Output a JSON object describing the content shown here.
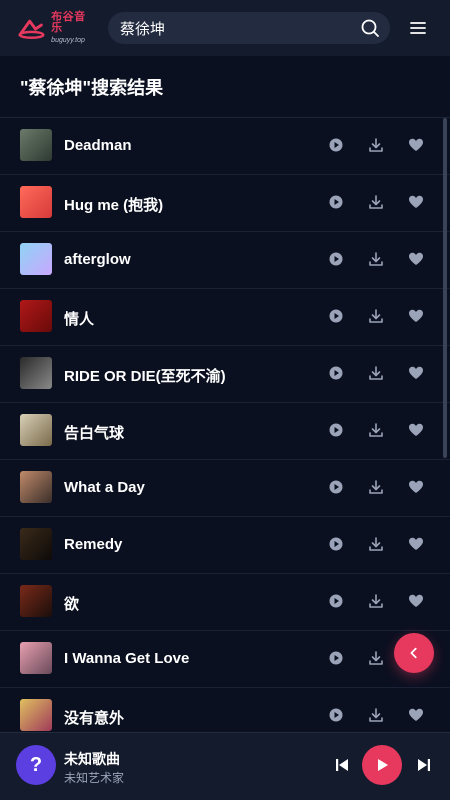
{
  "header": {
    "logo_text": "布谷音乐",
    "logo_sub": "buguyy.top",
    "search_value": "蔡徐坤"
  },
  "results_title": "\"蔡徐坤\"搜索结果",
  "songs": [
    {
      "title": "Deadman"
    },
    {
      "title": "Hug me (抱我)"
    },
    {
      "title": "afterglow"
    },
    {
      "title": "情人"
    },
    {
      "title": "RIDE OR DIE(至死不渝)"
    },
    {
      "title": "告白气球"
    },
    {
      "title": "What a Day"
    },
    {
      "title": "Remedy"
    },
    {
      "title": "欲"
    },
    {
      "title": "I Wanna Get Love"
    },
    {
      "title": "没有意外"
    }
  ],
  "player": {
    "cover_symbol": "?",
    "title": "未知歌曲",
    "artist": "未知艺术家"
  },
  "colors": {
    "accent": "#e7385e",
    "background": "#0b1020",
    "panel": "#141b2d"
  }
}
